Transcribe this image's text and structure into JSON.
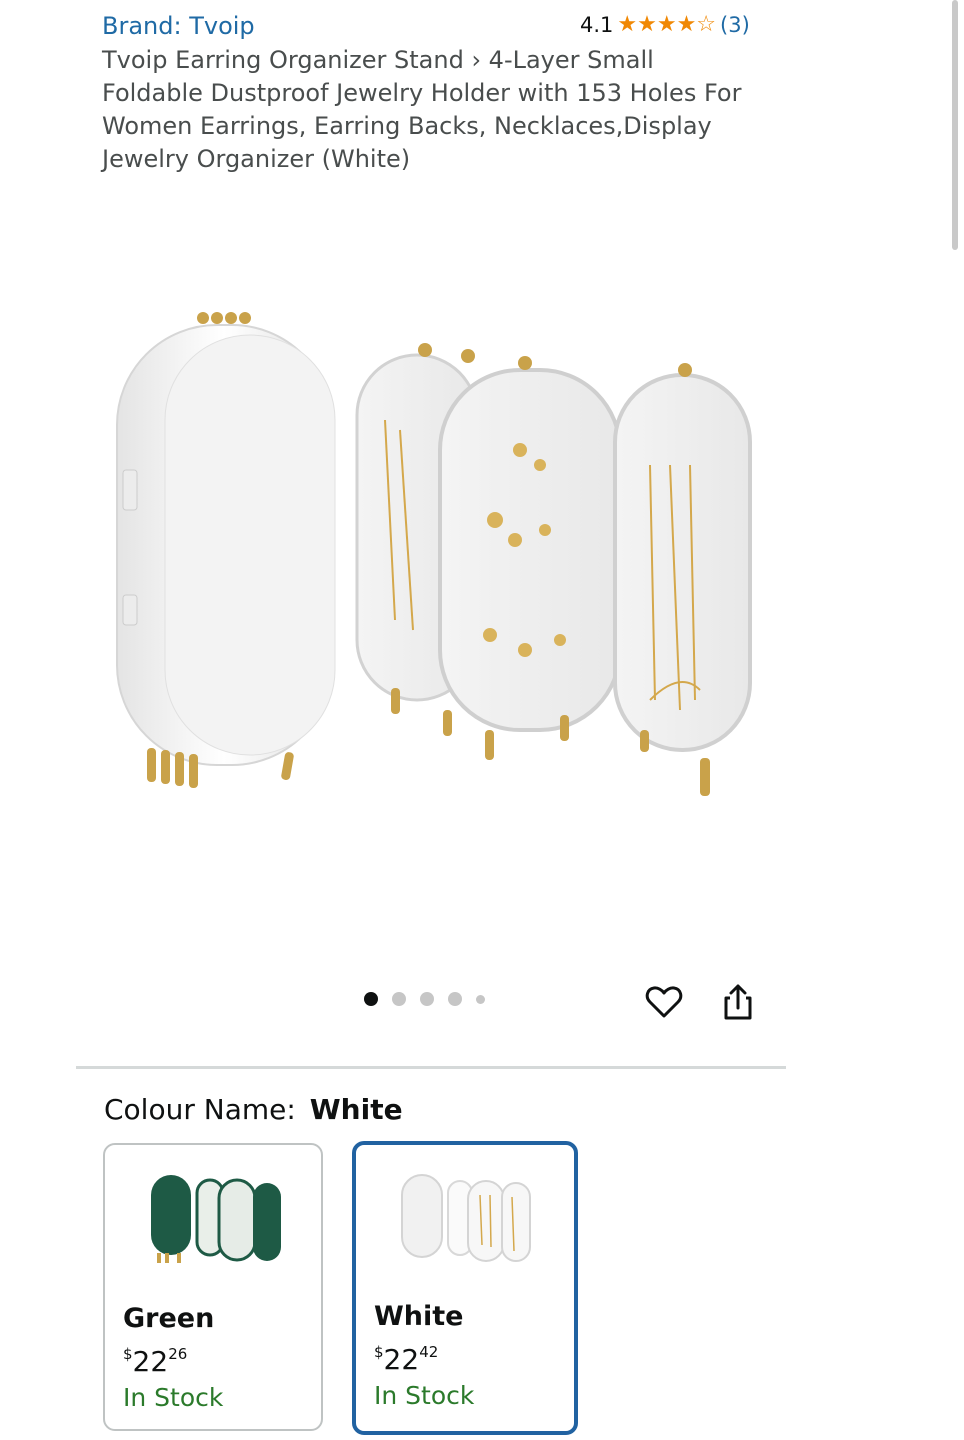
{
  "header": {
    "brand": "Brand: Tvoip",
    "rating_value": "4.1",
    "rating_stars": 4.1,
    "rating_count": "(3)",
    "title": "Tvoip Earring Organizer Stand › 4-Layer Small Foldable Dustproof Jewelry Holder with 153 Holes For Women Earrings, Earring Backs, Necklaces,Display Jewelry Organizer (White)"
  },
  "gallery": {
    "image_count": 5,
    "active_index": 0,
    "actions": [
      "heart-icon",
      "share-icon"
    ]
  },
  "colour": {
    "label": "Colour Name:",
    "selected": "White"
  },
  "variants": [
    {
      "name": "Green",
      "price_symbol": "$",
      "price_whole": "22",
      "price_fraction": "26",
      "stock": "In Stock",
      "color": "#1e5a45"
    },
    {
      "name": "White",
      "price_symbol": "$",
      "price_whole": "22",
      "price_fraction": "42",
      "stock": "In Stock",
      "color": "#f1f1f1"
    }
  ],
  "colors": {
    "link": "#1f6aa5",
    "star": "#f08804",
    "stock": "#2b7a2b",
    "selected_border": "#2162a1"
  }
}
